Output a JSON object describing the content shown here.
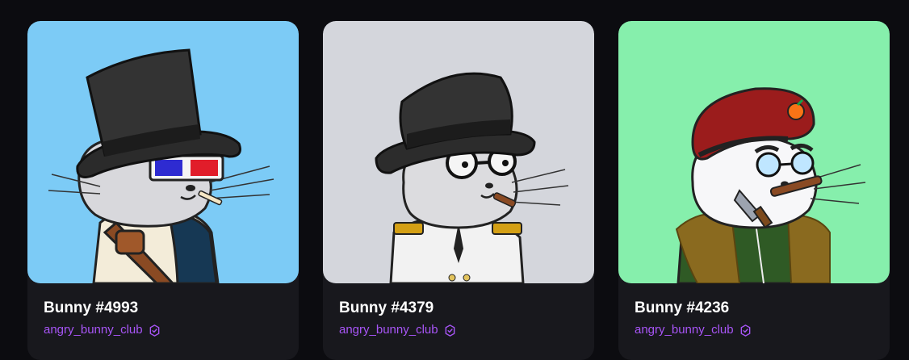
{
  "cards": [
    {
      "name": "Bunny #4993",
      "collection": "angry_bunny_club",
      "bg": "#7dd3fc",
      "icon": "verified-icon"
    },
    {
      "name": "Bunny #4379",
      "collection": "angry_bunny_club",
      "bg": "#d4d6dc",
      "icon": "verified-icon"
    },
    {
      "name": "Bunny #4236",
      "collection": "angry_bunny_club",
      "bg": "#86efac",
      "icon": "verified-icon"
    }
  ],
  "colors": {
    "page_bg": "#0c0c10",
    "card_bg": "#18181d",
    "accent": "#a855f7"
  }
}
